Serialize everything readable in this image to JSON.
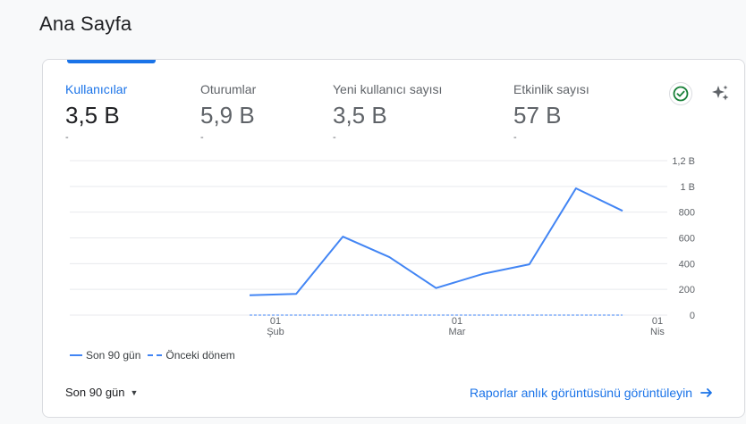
{
  "page": {
    "title": "Ana Sayfa"
  },
  "metrics": [
    {
      "label": "Kullanıcılar",
      "value": "3,5 B",
      "delta": "-",
      "active": true
    },
    {
      "label": "Oturumlar",
      "value": "5,9 B",
      "delta": "-",
      "active": false
    },
    {
      "label": "Yeni kullanıcı sayısı",
      "value": "3,5 B",
      "delta": "-",
      "active": false
    },
    {
      "label": "Etkinlik sayısı",
      "value": "57 B",
      "delta": "-",
      "active": false
    }
  ],
  "icons": {
    "status": "check-circle-icon",
    "insights": "sparkle-icon",
    "link": "arrow-right-icon",
    "dropdown": "caret-down-icon"
  },
  "colors": {
    "accent": "#1a73e8",
    "series": "#4285f4",
    "status_ok": "#188038"
  },
  "chart_data": {
    "type": "line",
    "y_ticks": [
      "1,2 B",
      "1 B",
      "800",
      "600",
      "400",
      "200",
      "0"
    ],
    "ylim": [
      0,
      1200
    ],
    "x_ticks": [
      {
        "day": "01",
        "month": "Şub"
      },
      {
        "day": "01",
        "month": "Mar"
      },
      {
        "day": "01",
        "month": "Nis"
      }
    ],
    "series": [
      {
        "name": "Son 90 gün",
        "style": "solid",
        "values": [
          155,
          165,
          610,
          450,
          210,
          320,
          395,
          985,
          810
        ]
      },
      {
        "name": "Önceki dönem",
        "style": "dashed",
        "values": [
          0,
          0,
          0,
          0,
          0,
          0,
          0,
          0,
          0
        ]
      }
    ],
    "grid": true,
    "legend_position": "bottom-left"
  },
  "footer": {
    "range_label": "Son 90 gün",
    "report_link": "Raporlar anlık görüntüsünü görüntüleyin"
  }
}
